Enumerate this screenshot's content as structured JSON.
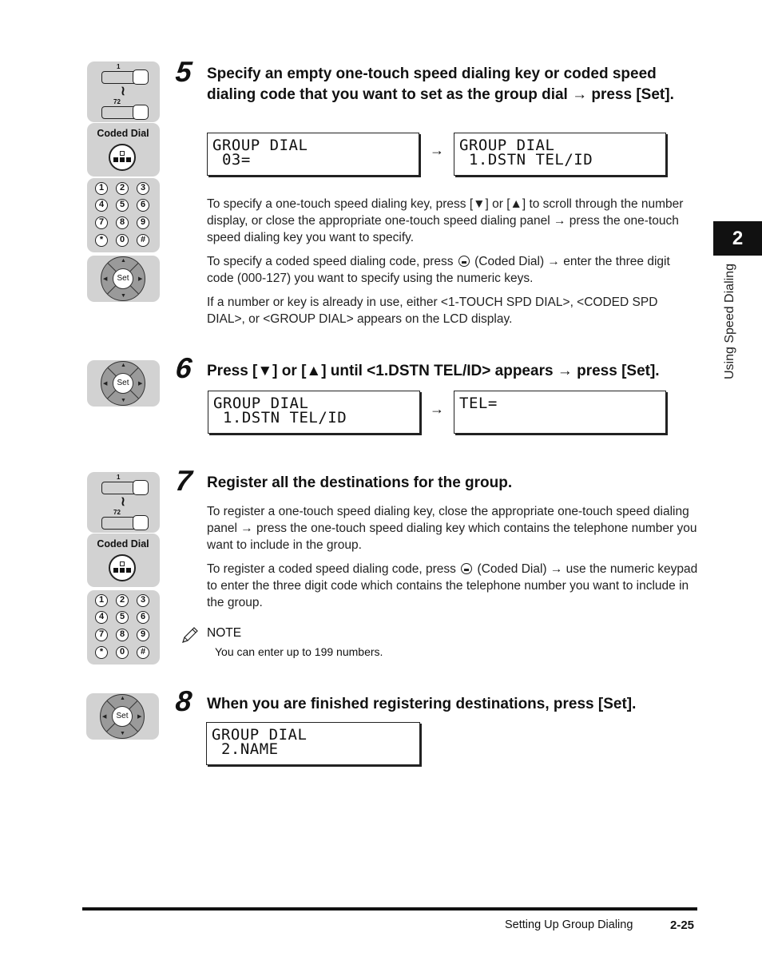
{
  "chapter": {
    "number": "2",
    "title": "Using Speed Dialing"
  },
  "panels": {
    "one_touch": {
      "top_label": "1",
      "bottom_label": "72"
    },
    "coded_dial": {
      "label": "Coded Dial"
    },
    "keypad": {
      "keys": [
        "1",
        "2",
        "3",
        "4",
        "5",
        "6",
        "7",
        "8",
        "9",
        "*",
        "0",
        "#"
      ]
    },
    "dpad": {
      "set_label": "Set"
    }
  },
  "steps": [
    {
      "number": "5",
      "heading": "Specify an empty one-touch speed dialing key or coded speed dialing code that you want to set as the group dial → press [Set].",
      "lcd_before": {
        "line1": "GROUP DIAL",
        "line2": " 03="
      },
      "lcd_after": {
        "line1": "GROUP DIAL",
        "line2": " 1.DSTN TEL/ID"
      },
      "paragraphs": [
        "To specify a one-touch speed dialing key, press [▼] or [▲] to scroll through the number display, or close the appropriate one-touch speed dialing panel → press the one-touch speed dialing key you want to specify.",
        "(Coded Dial) → enter the three digit code (000-127) you want to specify using the numeric keys.",
        "If a number or key is already in use, either <1-TOUCH SPD DIAL>, <CODED SPD DIAL>, or <GROUP DIAL> appears on the LCD display."
      ],
      "para2_prefix": "To specify a coded speed dialing code, press"
    },
    {
      "number": "6",
      "heading": "Press [▼] or [▲] until <1.DSTN TEL/ID> appears → press [Set].",
      "lcd_before": {
        "line1": "GROUP DIAL",
        "line2": " 1.DSTN TEL/ID"
      },
      "lcd_after": {
        "line1": "TEL=",
        "line2": ""
      }
    },
    {
      "number": "7",
      "heading": "Register all the destinations for the group.",
      "paragraphs": [
        "To register a one-touch speed dialing key, close the appropriate one-touch speed dialing panel → press the one-touch speed dialing key which contains the telephone number you want to include in the group.",
        "(Coded Dial) → use the numeric keypad to enter the three digit code which contains the telephone number you want to include in the group."
      ],
      "para2_prefix": "To register a coded speed dialing code, press",
      "note": {
        "label": "NOTE",
        "text": "You can enter up to 199 numbers."
      }
    },
    {
      "number": "8",
      "heading": "When you are finished registering destinations, press [Set].",
      "lcd": {
        "line1": "GROUP DIAL",
        "line2": " 2.NAME"
      }
    }
  ],
  "arrow_symbol": "→",
  "footer": {
    "section_title": "Setting Up Group Dialing",
    "page_number": "2-25"
  }
}
